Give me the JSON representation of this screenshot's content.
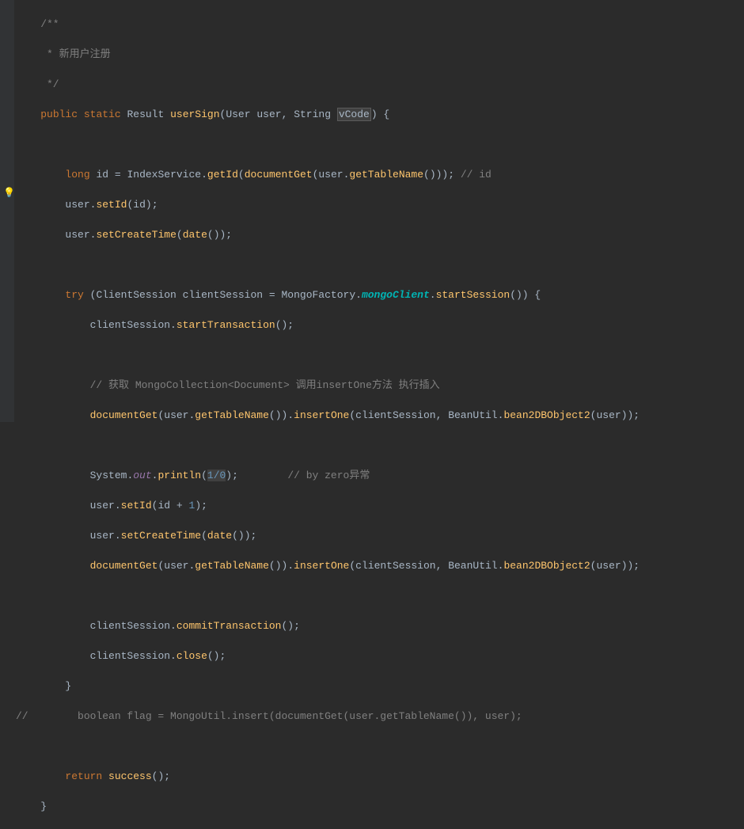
{
  "lines": {
    "l01": "    /**",
    "l02": "     * 新用户注册",
    "l03": "     */",
    "l04a": "    ",
    "l04_public": "public",
    "l04_static": "static",
    "l04_Result": "Result",
    "l04_userSign": "userSign",
    "l04_User": "User",
    "l04_user": "user",
    "l04_String": "String",
    "l04_vCode": "vCode",
    "l04_brace": ") {",
    "l06_indent": "        ",
    "l06_long": "long",
    "l06_id": "id",
    "l06_eq": " = ",
    "l06_IndexService": "IndexService",
    "l06_getId": "getId",
    "l06_documentGet": "documentGet",
    "l06_user": "user",
    "l06_getTableName": "getTableName",
    "l06_comment": "// id",
    "l07_user": "user",
    "l07_setId": "setId",
    "l07_id": "id",
    "l08_user": "user",
    "l08_setCreateTime": "setCreateTime",
    "l08_date": "date",
    "l10_try": "try",
    "l10_ClientSession": "ClientSession",
    "l10_clientSession": "clientSession",
    "l10_MongoFactory": "MongoFactory",
    "l10_mongoClient": "mongoClient",
    "l10_startSession": "startSession",
    "l11_clientSession": "clientSession",
    "l11_startTransaction": "startTransaction",
    "l13_comment": "// 获取 MongoCollection<Document> 调用insertOne方法 执行插入",
    "l14_documentGet": "documentGet",
    "l14_user": "user",
    "l14_getTableName": "getTableName",
    "l14_insertOne": "insertOne",
    "l14_clientSession": "clientSession",
    "l14_BeanUtil": "BeanUtil",
    "l14_bean2": "bean2DBObject2",
    "l14_user2": "user",
    "l16_System": "System",
    "l16_out": "out",
    "l16_println": "println",
    "l16_10": "1/0",
    "l16_comment": "// by zero异常",
    "l17_user": "user",
    "l17_setId": "setId",
    "l17_id": "id",
    "l17_1": "1",
    "l18_user": "user",
    "l18_setCreateTime": "setCreateTime",
    "l18_date": "date",
    "l19_documentGet": "documentGet",
    "l19_user": "user",
    "l19_getTableName": "getTableName",
    "l19_insertOne": "insertOne",
    "l19_clientSession": "clientSession",
    "l19_BeanUtil": "BeanUtil",
    "l19_bean2": "bean2DBObject2",
    "l19_user2": "user",
    "l21_clientSession": "clientSession",
    "l21_commitTransaction": "commitTransaction",
    "l22_clientSession": "clientSession",
    "l22_close": "close",
    "l23_brace": "        }",
    "l24_comment": "//        boolean flag = MongoUtil.insert(documentGet(user.getTableName()), user);",
    "l26_return": "return",
    "l26_success": "success",
    "l27_brace": "    }"
  }
}
